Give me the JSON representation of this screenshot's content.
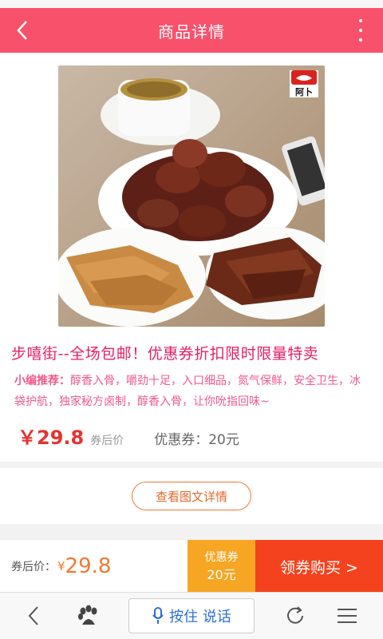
{
  "header": {
    "title": "商品详情"
  },
  "product": {
    "brand_badge": "阿卜",
    "title": "步嘻街--全场包邮！优惠券折扣限时限量特卖",
    "recommend_label": "小编推荐：",
    "recommend_text": "醇香入骨，嚼劲十足，入口细品，氮气保鲜，安全卫生，冰袋护航，独家秘方卤制，醇香入骨，让你吮指回味~",
    "price": "￥29.8",
    "price_note": "券后价",
    "coupon_info": "优惠券：20元"
  },
  "detail": {
    "button_label": "查看图文详情"
  },
  "buy_bar": {
    "price_label": "券后价：",
    "currency": "¥",
    "price": "29.8",
    "coupon_label": "优惠券",
    "coupon_amount": "20元",
    "buy_label": "领券购买 >"
  },
  "browser": {
    "voice_label": "按住 说话"
  },
  "colors": {
    "header": "#f8516c",
    "title": "#e91e63",
    "price": "#e8322f",
    "coupon_bg": "#f6a623",
    "buy_bg": "#f5421e"
  }
}
